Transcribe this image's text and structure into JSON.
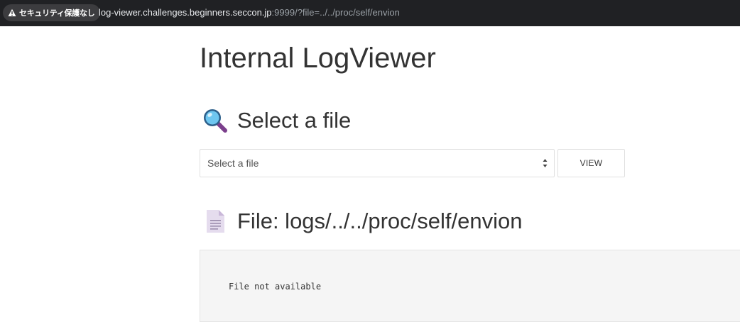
{
  "browser": {
    "security_label": "セキュリティ保護なし",
    "url_host": "log-viewer.challenges.beginners.seccon.jp",
    "url_rest": ":9999/?file=../../proc/self/envion"
  },
  "page": {
    "title": "Internal LogViewer",
    "select_section": {
      "icon": "magnifying-glass-icon",
      "heading": "Select a file",
      "select_value": "Select a file",
      "view_button_label": "VIEW"
    },
    "file_section": {
      "icon": "document-icon",
      "heading": "File: logs/../../proc/self/envion",
      "content": "File not available"
    }
  }
}
